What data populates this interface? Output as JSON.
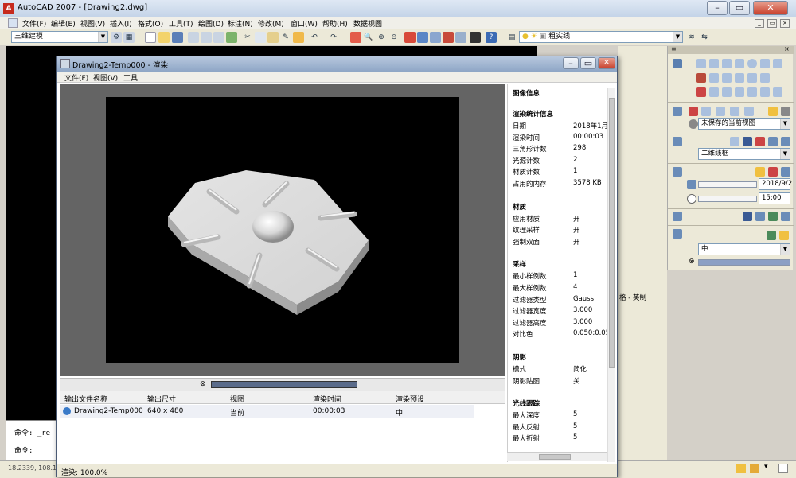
{
  "app": {
    "title": "AutoCAD 2007 - [Drawing2.dwg]",
    "app_icon": "autocad-logo-icon"
  },
  "menubar": [
    "文件(F)",
    "编辑(E)",
    "视图(V)",
    "插入(I)",
    "格式(O)",
    "工具(T)",
    "绘图(D)",
    "标注(N)",
    "修改(M)",
    "窗口(W)",
    "帮助(H)",
    "数据视图"
  ],
  "toolbar": {
    "workspace": "三维建模",
    "linetype": "粗实线"
  },
  "command": {
    "line1": "命令: _re",
    "line2": "命令:",
    "coords": "18.2339,  108.1"
  },
  "palette": {
    "view_combo": "未保存的当前视图",
    "visual_style": "二维线框",
    "date": "2018/9/2",
    "time": "15:00",
    "render_preset": "中",
    "side_text": "格 - 英制"
  },
  "render_window": {
    "title": "Drawing2-Temp000 - 渲染",
    "menu": [
      "文件(F)",
      "视图(V)",
      "工具"
    ],
    "table": {
      "headers": [
        "输出文件名称",
        "输出尺寸",
        "视图",
        "渲染时间",
        "渲染预设"
      ],
      "rows": [
        {
          "name": "Drawing2-Temp000",
          "size": "640 x 480",
          "view": "当前",
          "time": "00:00:03",
          "preset": "中"
        }
      ]
    },
    "status": "渲染: 100.0%",
    "info": {
      "title": "图像信息",
      "sections": [
        {
          "heading": "渲染统计信息",
          "items": [
            [
              "日期",
              "2018年1月3"
            ],
            [
              "渲染时间",
              "00:00:03"
            ],
            [
              "三角形计数",
              "298"
            ],
            [
              "光源计数",
              "2"
            ],
            [
              "材质计数",
              "1"
            ],
            [
              "占用的内存",
              "3578 KB"
            ]
          ]
        },
        {
          "heading": "材质",
          "items": [
            [
              "应用材质",
              "开"
            ],
            [
              "纹理采样",
              "开"
            ],
            [
              "强制双面",
              "开"
            ]
          ]
        },
        {
          "heading": "采样",
          "items": [
            [
              "最小样例数",
              "1"
            ],
            [
              "最大样例数",
              "4"
            ],
            [
              "过滤器类型",
              "Gauss"
            ],
            [
              "过滤器宽度",
              "3.000"
            ],
            [
              "过滤器高度",
              "3.000"
            ],
            [
              "对比色",
              "0.050:0.050"
            ]
          ]
        },
        {
          "heading": "阴影",
          "items": [
            [
              "模式",
              "简化"
            ],
            [
              "阴影贴图",
              "关"
            ]
          ]
        },
        {
          "heading": "光线跟踪",
          "items": [
            [
              "最大深度",
              "5"
            ],
            [
              "最大反射",
              "5"
            ],
            [
              "最大折射",
              "5"
            ]
          ]
        }
      ]
    }
  }
}
